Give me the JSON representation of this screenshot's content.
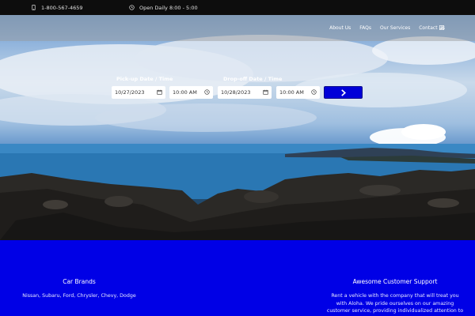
{
  "topbar": {
    "phone": "1-800-567-4659",
    "hours": "Open Daily 8:00 - 5:00",
    "phone_icon": "phone-icon",
    "clock_icon": "clock-icon"
  },
  "nav": {
    "items": [
      "About Us",
      "FAQs",
      "Our Services",
      "Contact Us"
    ],
    "menu_icon": "hamburger-menu-icon"
  },
  "booking": {
    "pickup_label": "Pick-up Date / Time",
    "pickup_date": "10/27/2023",
    "pickup_time": "10:00 AM",
    "dropoff_label": "Drop-off Date / Time",
    "dropoff_date": "10/28/2023",
    "dropoff_time": "10:00 AM",
    "submit_icon": "chevron-right-icon",
    "calendar_icon": "calendar-icon",
    "time_icon": "clock-icon"
  },
  "features": {
    "brands_title": "Car Brands",
    "brands_text": "Nissan, Subaru, Ford, Chrysler, Chevy, Dodge",
    "support_title": "Awesome Customer Support",
    "support_text": "Rent a vehicle with the company that will treat you with Aloha. We pride ourselves on our amazing customer service, providing individualized attention to all our customers."
  },
  "colors": {
    "accent_blue": "#0000e6",
    "topbar_bg": "#0d0d0d"
  }
}
